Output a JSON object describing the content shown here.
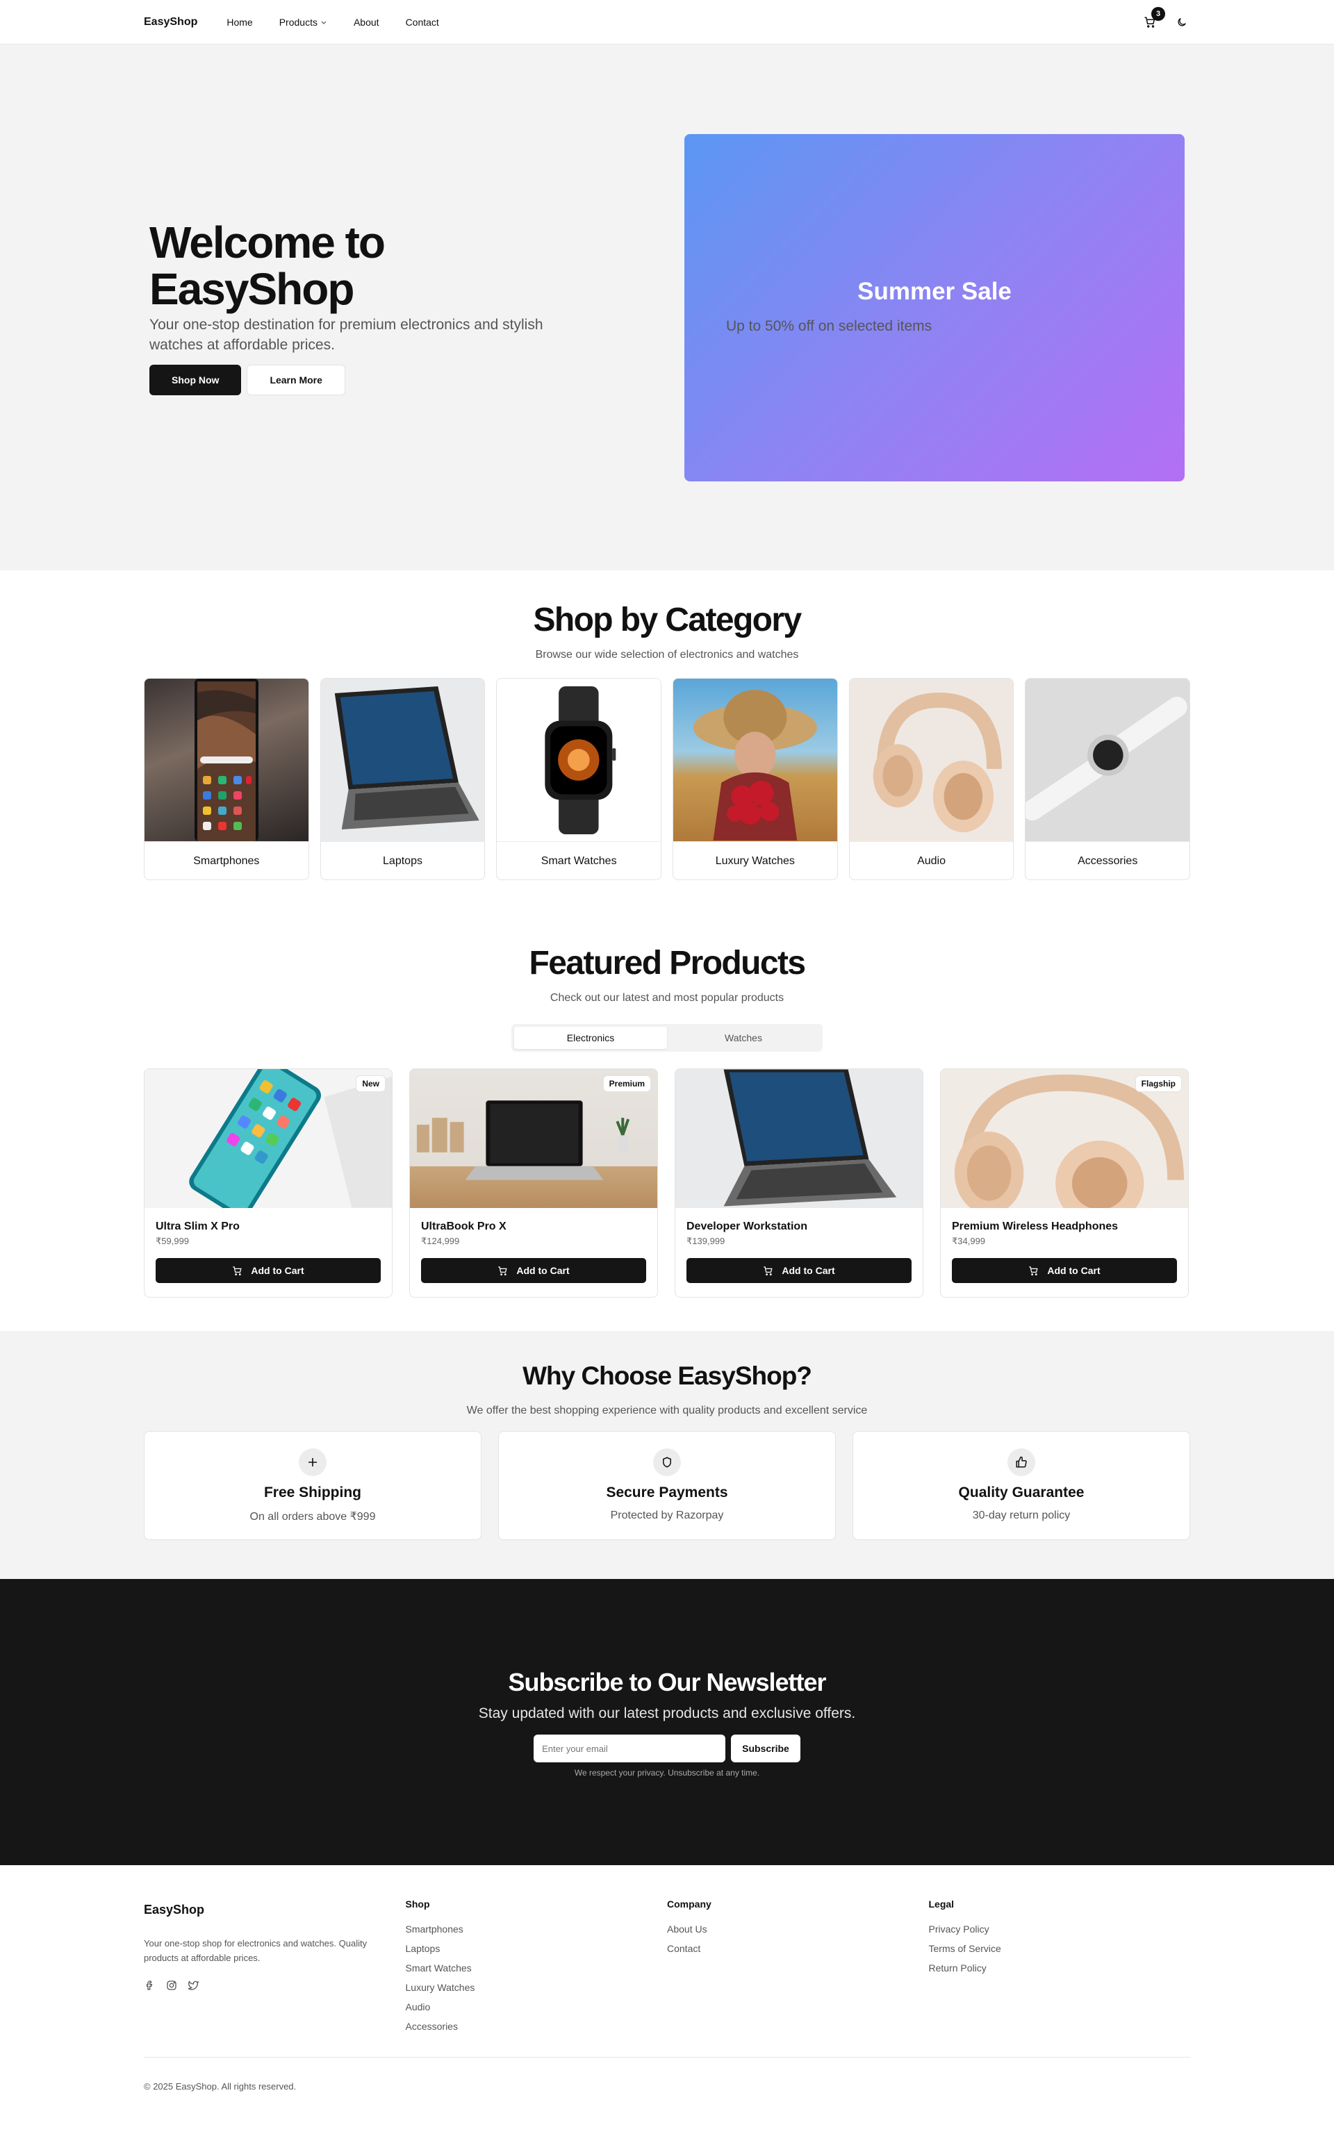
{
  "header": {
    "brand": "EasyShop",
    "nav": [
      {
        "label": "Home"
      },
      {
        "label": "Products",
        "icon": "chevron-down-icon"
      },
      {
        "label": "About"
      },
      {
        "label": "Contact"
      }
    ],
    "cart_count": "3"
  },
  "hero": {
    "title": "Welcome to EasyShop",
    "subtitle": "Your one-stop destination for premium electronics and stylish watches at affordable prices.",
    "primary_button": "Shop Now",
    "secondary_button": "Learn More",
    "banner_title": "Summer Sale",
    "banner_subtitle": "Up to 50% off on selected items",
    "banner_gradient": [
      "#5b97f3",
      "#b46ff4"
    ]
  },
  "categories": {
    "title": "Shop by Category",
    "subtitle": "Browse our wide selection of electronics and watches",
    "items": [
      {
        "label": "Smartphones"
      },
      {
        "label": "Laptops"
      },
      {
        "label": "Smart Watches"
      },
      {
        "label": "Luxury Watches"
      },
      {
        "label": "Audio"
      },
      {
        "label": "Accessories"
      }
    ]
  },
  "featured": {
    "title": "Featured Products",
    "subtitle": "Check out our latest and most popular products",
    "tabs": [
      "Electronics",
      "Watches"
    ],
    "active_tab": "Electronics",
    "add_to_cart": "Add to Cart",
    "products": [
      {
        "name": "Ultra Slim X Pro",
        "price": "₹59,999",
        "badge": "New"
      },
      {
        "name": "UltraBook Pro X",
        "price": "₹124,999",
        "badge": "Premium"
      },
      {
        "name": "Developer Workstation",
        "price": "₹139,999",
        "badge": ""
      },
      {
        "name": "Premium Wireless Headphones",
        "price": "₹34,999",
        "badge": "Flagship"
      }
    ]
  },
  "why": {
    "title": "Why Choose EasyShop?",
    "subtitle": "We offer the best shopping experience with quality products and excellent service",
    "features": [
      {
        "title": "Free Shipping",
        "subtitle": "On all orders above ₹999",
        "icon": "plus-icon"
      },
      {
        "title": "Secure Payments",
        "subtitle": "Protected by Razorpay",
        "icon": "shield-icon"
      },
      {
        "title": "Quality Guarantee",
        "subtitle": "30-day return policy",
        "icon": "thumbs-up-icon"
      }
    ]
  },
  "newsletter": {
    "title": "Subscribe to Our Newsletter",
    "subtitle": "Stay updated with our latest products and exclusive offers.",
    "placeholder": "Enter your email",
    "button": "Subscribe",
    "note": "We respect your privacy. Unsubscribe at any time."
  },
  "footer": {
    "brand": "EasyShop",
    "description": "Your one-stop shop for electronics and watches. Quality products at affordable prices.",
    "columns": [
      {
        "heading": "Shop",
        "links": [
          "Smartphones",
          "Laptops",
          "Smart Watches",
          "Luxury Watches",
          "Audio",
          "Accessories"
        ]
      },
      {
        "heading": "Company",
        "links": [
          "About Us",
          "Contact"
        ]
      },
      {
        "heading": "Legal",
        "links": [
          "Privacy Policy",
          "Terms of Service",
          "Return Policy"
        ]
      }
    ],
    "copyright": "© 2025 EasyShop. All rights reserved."
  }
}
